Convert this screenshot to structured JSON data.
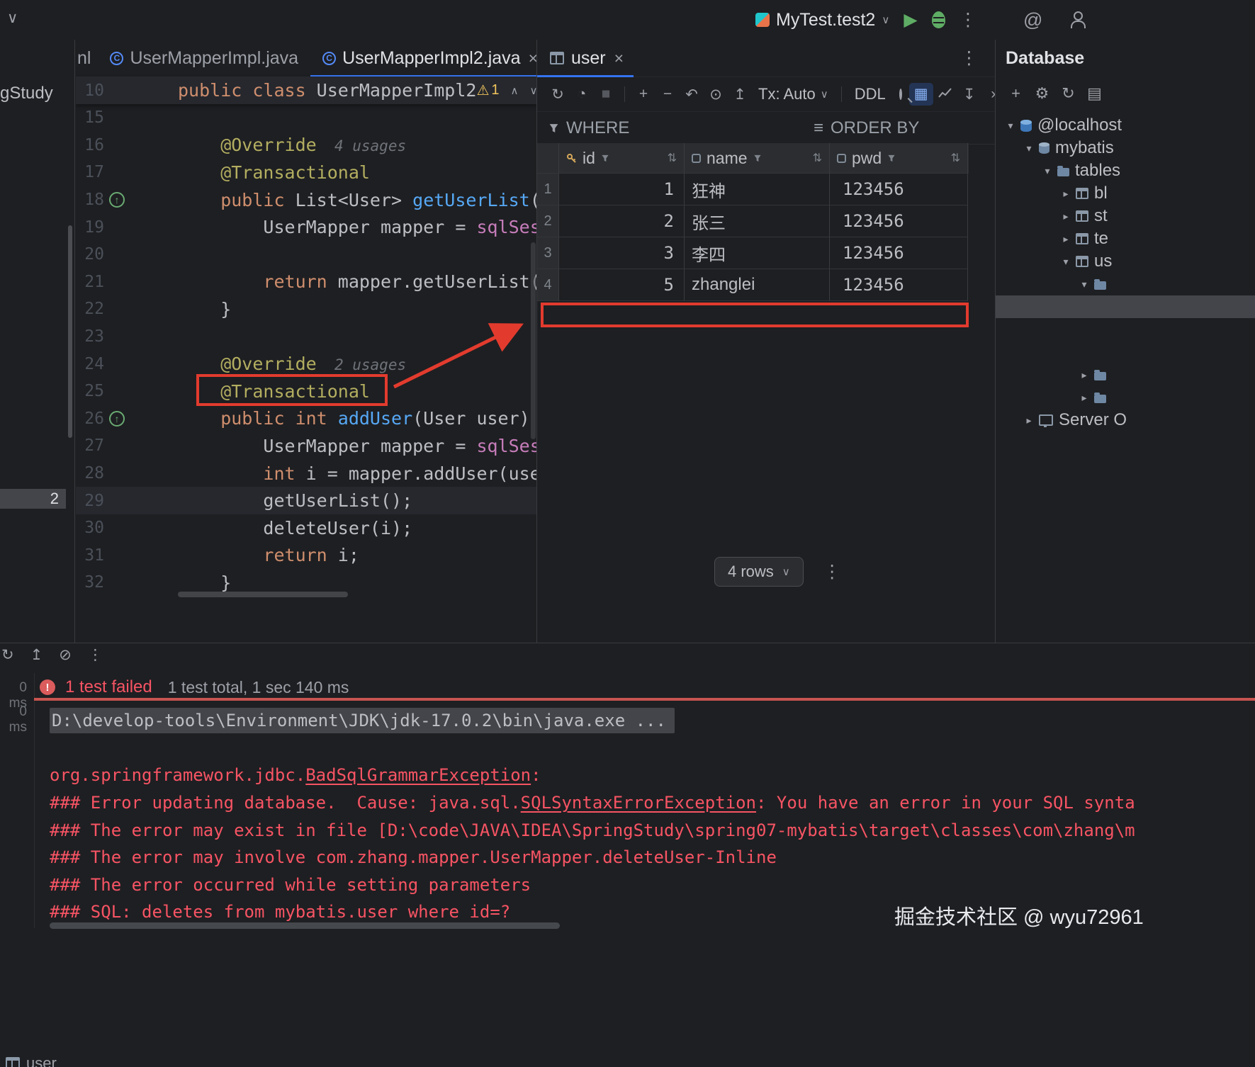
{
  "icons": {
    "chevron_down": "∨",
    "chevron_up": "∧",
    "tree_expanded": "▾",
    "tree_collapsed": "▸",
    "close": "×",
    "more": "⋮",
    "run": "▶",
    "refresh": "↻",
    "clock": "◔",
    "stop": "■",
    "plus": "+",
    "minus": "−",
    "undo": "↶",
    "commit": "⊙",
    "upload": "↥",
    "warning": "⚠",
    "grid_view": "▦",
    "export": "↧",
    "chevron_right": "›",
    "sort": "⇅",
    "sort_lines": "≡",
    "gear": "⚙",
    "mention": "@",
    "slash": "⊘",
    "panel": "▤",
    "error_mark": "!"
  },
  "titlebar": {
    "run_config": "MyTest.test2"
  },
  "project": {
    "partial_name": "gStudy",
    "badge": "2"
  },
  "editor": {
    "partial_tab": "nl",
    "tabs": [
      {
        "label": "UserMapperImpl.java"
      },
      {
        "label": "UserMapperImpl2.java"
      }
    ],
    "sticky": {
      "num": "10",
      "kw": "public class ",
      "cls": "UserMapperImpl2",
      "warning_count": "1"
    },
    "lines": [
      {
        "num": "15",
        "segs": []
      },
      {
        "num": "16",
        "segs": [
          {
            "c": "ann",
            "t": "    @Override"
          },
          {
            "c": "hint",
            "t": "  4 usages"
          }
        ]
      },
      {
        "num": "17",
        "segs": [
          {
            "c": "ann",
            "t": "    @Transactional"
          }
        ]
      },
      {
        "num": "18",
        "marker": true,
        "segs": [
          {
            "c": "kw",
            "t": "    public "
          },
          {
            "c": "txt",
            "t": "List<User> "
          },
          {
            "c": "mth",
            "t": "getUserList"
          },
          {
            "c": "txt",
            "t": "()"
          }
        ]
      },
      {
        "num": "19",
        "segs": [
          {
            "c": "txt",
            "t": "        UserMapper mapper = "
          },
          {
            "c": "fld",
            "t": "sqlSessi"
          }
        ]
      },
      {
        "num": "20",
        "segs": []
      },
      {
        "num": "21",
        "segs": [
          {
            "c": "kw",
            "t": "        return "
          },
          {
            "c": "txt",
            "t": "mapper.getUserList();"
          }
        ]
      },
      {
        "num": "22",
        "segs": [
          {
            "c": "txt",
            "t": "    }"
          }
        ]
      },
      {
        "num": "23",
        "segs": []
      },
      {
        "num": "24",
        "segs": [
          {
            "c": "ann",
            "t": "    @Override"
          },
          {
            "c": "hint",
            "t": "  2 usages"
          }
        ]
      },
      {
        "num": "25",
        "segs": [
          {
            "c": "ann",
            "t": "    @Transactional"
          }
        ]
      },
      {
        "num": "26",
        "marker": true,
        "segs": [
          {
            "c": "kw",
            "t": "    public int "
          },
          {
            "c": "mth",
            "t": "addUser"
          },
          {
            "c": "txt",
            "t": "(User user) {"
          }
        ]
      },
      {
        "num": "27",
        "segs": [
          {
            "c": "txt",
            "t": "        UserMapper mapper = "
          },
          {
            "c": "fld",
            "t": "sqlSessi"
          }
        ]
      },
      {
        "num": "28",
        "segs": [
          {
            "c": "kw",
            "t": "        int "
          },
          {
            "c": "txt",
            "t": "i = mapper.addUser(user)"
          }
        ]
      },
      {
        "num": "29",
        "current": true,
        "segs": [
          {
            "c": "txt",
            "t": "        getUserList();"
          }
        ]
      },
      {
        "num": "30",
        "segs": [
          {
            "c": "txt",
            "t": "        deleteUser(i);"
          }
        ]
      },
      {
        "num": "31",
        "segs": [
          {
            "c": "kw",
            "t": "        return "
          },
          {
            "c": "txt",
            "t": "i;"
          }
        ]
      },
      {
        "num": "32",
        "segs": [
          {
            "c": "txt",
            "t": "    }"
          }
        ]
      }
    ]
  },
  "grid": {
    "tab": "user",
    "toolbar": {
      "tx": "Tx: Auto",
      "ddl": "DDL"
    },
    "filter": {
      "where": "WHERE",
      "order_by": "ORDER BY"
    },
    "columns": [
      "id",
      "name",
      "pwd"
    ],
    "rows": [
      {
        "n": "1",
        "id": "1",
        "name": "狂神",
        "pwd": "123456"
      },
      {
        "n": "2",
        "id": "2",
        "name": "张三",
        "pwd": "123456"
      },
      {
        "n": "3",
        "id": "3",
        "name": "李四",
        "pwd": "123456"
      },
      {
        "n": "4",
        "id": "5",
        "name": "zhanglei",
        "pwd": "123456"
      }
    ],
    "footer": {
      "rows_label": "4 rows"
    }
  },
  "database": {
    "title": "Database",
    "tree": [
      {
        "label": "@localhost",
        "icon": "ds",
        "chev": "expanded",
        "indent": 0
      },
      {
        "label": "mybatis",
        "icon": "schema",
        "chev": "expanded",
        "indent": 1
      },
      {
        "label": "tables",
        "icon": "folder",
        "chev": "expanded",
        "indent": 2
      },
      {
        "label": "bl",
        "icon": "table",
        "chev": "collapsed",
        "indent": 3
      },
      {
        "label": "st",
        "icon": "table",
        "chev": "collapsed",
        "indent": 3
      },
      {
        "label": "te",
        "icon": "table",
        "chev": "collapsed",
        "indent": 3
      },
      {
        "label": "us",
        "icon": "table",
        "chev": "expanded",
        "indent": 3
      },
      {
        "label": "",
        "icon": "folder",
        "chev": "expanded",
        "indent": 4
      },
      {
        "label": "",
        "icon": "",
        "chev": "",
        "indent": 4,
        "selected": true
      },
      {
        "label": "",
        "icon": "",
        "chev": "",
        "indent": 4
      },
      {
        "label": "",
        "icon": "",
        "chev": "",
        "indent": 4
      },
      {
        "label": "",
        "icon": "folder",
        "chev": "collapsed",
        "indent": 4
      },
      {
        "label": "",
        "icon": "folder",
        "chev": "collapsed",
        "indent": 4
      },
      {
        "label": "Server O",
        "icon": "server",
        "chev": "collapsed",
        "indent": 1
      }
    ]
  },
  "tests": {
    "failed_label": "1 test failed",
    "summary": "1 test total, 1 sec 140 ms",
    "durations": [
      "0 ms",
      "0 ms"
    ]
  },
  "console": {
    "lines": [
      {
        "segs": [
          {
            "c": "sel",
            "t": "D:\\develop-tools\\Environment\\JDK\\jdk-17.0.2\\bin\\java.exe ..."
          }
        ]
      },
      {
        "segs": []
      },
      {
        "segs": [
          {
            "c": "err",
            "t": "org.springframework.jdbc."
          },
          {
            "c": "err u",
            "t": "BadSqlGrammarException"
          },
          {
            "c": "err",
            "t": ":"
          }
        ]
      },
      {
        "segs": [
          {
            "c": "err",
            "t": "### Error updating database.  Cause: java.sql."
          },
          {
            "c": "err u",
            "t": "SQLSyntaxErrorException"
          },
          {
            "c": "err",
            "t": ": You have an error in your SQL synta"
          }
        ]
      },
      {
        "segs": [
          {
            "c": "err",
            "t": "### The error may exist in file [D:\\code\\JAVA\\IDEA\\SpringStudy\\spring07-mybatis\\target\\classes\\com\\zhang\\m"
          }
        ]
      },
      {
        "segs": [
          {
            "c": "err",
            "t": "### The error may involve com.zhang.mapper.UserMapper.deleteUser-Inline"
          }
        ]
      },
      {
        "segs": [
          {
            "c": "err",
            "t": "### The error occurred while setting parameters"
          }
        ]
      },
      {
        "segs": [
          {
            "c": "err",
            "t": "### SQL: deletes from mybatis.user where id=?"
          }
        ]
      }
    ]
  },
  "bottom_tab": "user",
  "watermark": "掘金技术社区 @ wyu72961"
}
